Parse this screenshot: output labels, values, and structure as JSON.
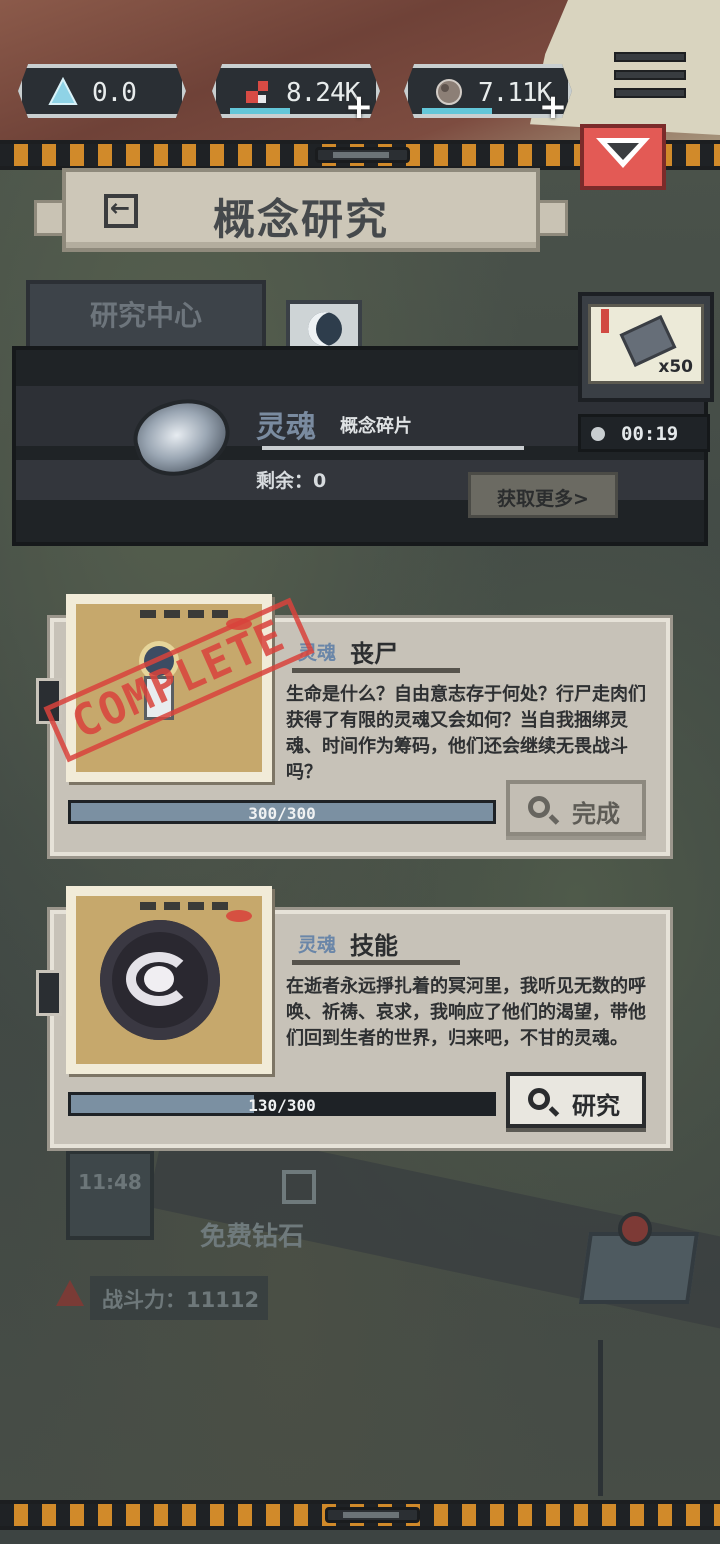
{
  "resources": [
    {
      "icon": "triangle-gem-icon",
      "value": "0.0",
      "has_plus": false,
      "bar_fraction": 0
    },
    {
      "icon": "blood-shard-icon",
      "value": "8.24K",
      "has_plus": true,
      "bar_fraction": 0.4
    },
    {
      "icon": "ore-chunk-icon",
      "value": "7.11K",
      "has_plus": true,
      "bar_fraction": 0.5
    }
  ],
  "header": {
    "title": "概念研究"
  },
  "tabs": {
    "research_center": "研究中心"
  },
  "material": {
    "name": "灵魂",
    "subtitle": "概念碎片",
    "remaining": "剩余：0",
    "get_more": "获取更多>"
  },
  "reward": {
    "count": "x50",
    "timer": "00:19"
  },
  "cards": [
    {
      "type": "灵魂",
      "name": "丧尸",
      "description": "生命是什么？自由意志存于何处？行尸走肉们获得了有限的灵魂又会如何？当自我捆绑灵魂、时间作为筹码，他们还会继续无畏战斗吗？",
      "progress": "300/300",
      "progress_fraction": 1.0,
      "button": "完成",
      "stamp": "COMPLETE"
    },
    {
      "type": "灵魂",
      "name": "技能",
      "description": "在逝者永远掙扎着的冥河里，我听见无数的呼唤、祈祷、哀求，我响应了他们的渴望，带他们回到生者的世界，归来吧，不甘的灵魂。",
      "progress": "130/300",
      "progress_fraction": 0.4333,
      "button": "研究"
    }
  ],
  "background": {
    "timer": "11:48",
    "free_diamond": "免费钻石",
    "power": "战斗力：11112"
  },
  "colors": {
    "accent_red": "#e35a55",
    "progress_fill": "#7b90a2",
    "hazard_orange": "#d18a2a",
    "soul_blue": "#7a8ba0"
  }
}
